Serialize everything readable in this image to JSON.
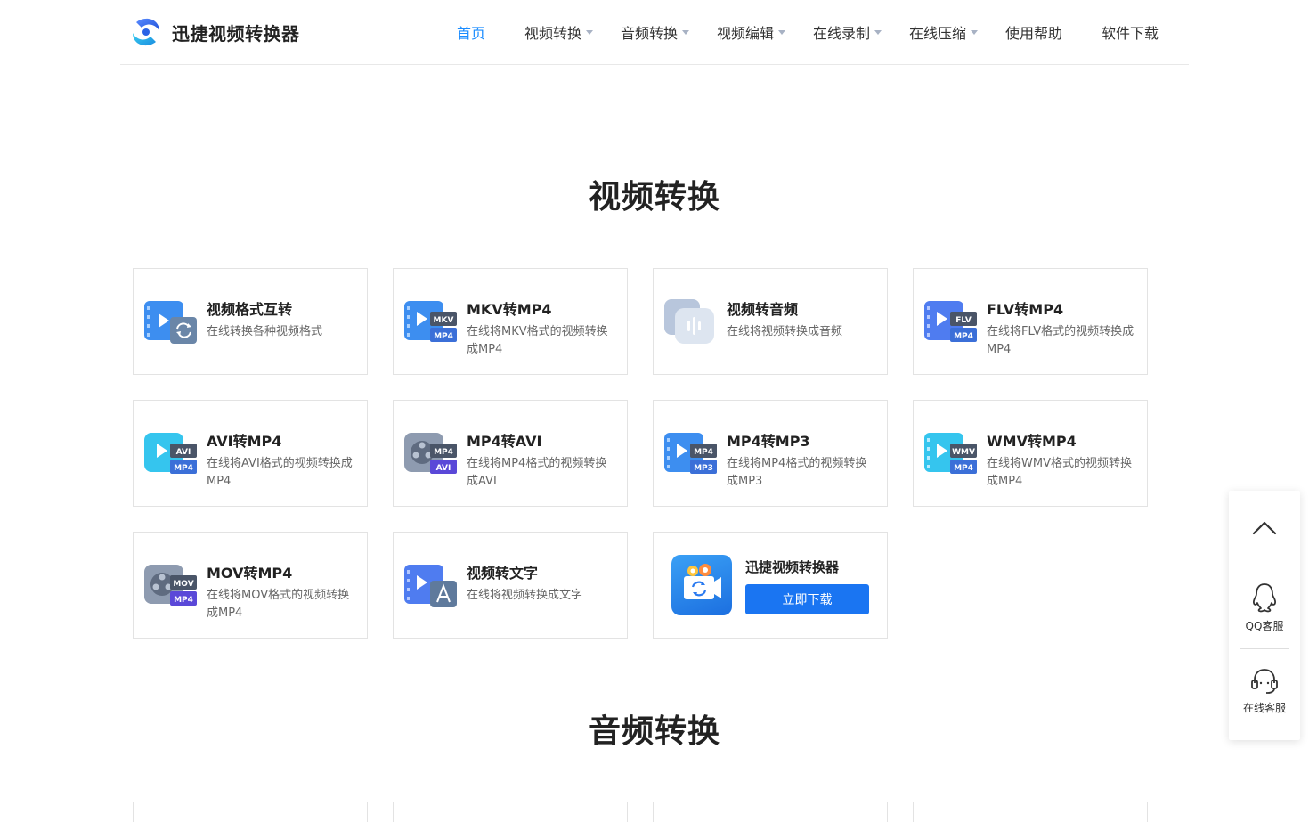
{
  "brand": {
    "name": "迅捷视频转换器"
  },
  "nav": {
    "items": [
      {
        "label": "首页",
        "active": true,
        "dropdown": false
      },
      {
        "label": "视频转换",
        "active": false,
        "dropdown": true
      },
      {
        "label": "音频转换",
        "active": false,
        "dropdown": true
      },
      {
        "label": "视频编辑",
        "active": false,
        "dropdown": true
      },
      {
        "label": "在线录制",
        "active": false,
        "dropdown": true
      },
      {
        "label": "在线压缩",
        "active": false,
        "dropdown": true
      },
      {
        "label": "使用帮助",
        "active": false,
        "dropdown": false
      },
      {
        "label": "软件下载",
        "active": false,
        "dropdown": false
      }
    ]
  },
  "video_section": {
    "title": "视频转换",
    "cards": [
      {
        "title": "视频格式互转",
        "desc": "在线转换各种视频格式",
        "icon": "video-format-convert-icon"
      },
      {
        "title": "MKV转MP4",
        "desc": "在线将MKV格式的视频转换成MP4",
        "icon": "mkv-to-mp4-icon",
        "badges": [
          "MKV",
          "MP4"
        ]
      },
      {
        "title": "视频转音频",
        "desc": "在线将视频转换成音频",
        "icon": "video-to-audio-icon"
      },
      {
        "title": "FLV转MP4",
        "desc": "在线将FLV格式的视频转换成MP4",
        "icon": "flv-to-mp4-icon",
        "badges": [
          "FLV",
          "MP4"
        ]
      },
      {
        "title": "AVI转MP4",
        "desc": "在线将AVI格式的视频转换成MP4",
        "icon": "avi-to-mp4-icon",
        "badges": [
          "AVI",
          "MP4"
        ]
      },
      {
        "title": "MP4转AVI",
        "desc": "在线将MP4格式的视频转换成AVI",
        "icon": "mp4-to-avi-icon",
        "badges": [
          "MP4",
          "AVI"
        ]
      },
      {
        "title": "MP4转MP3",
        "desc": "在线将MP4格式的视频转换成MP3",
        "icon": "mp4-to-mp3-icon",
        "badges": [
          "MP4",
          "MP3"
        ]
      },
      {
        "title": "WMV转MP4",
        "desc": "在线将WMV格式的视频转换成MP4",
        "icon": "wmv-to-mp4-icon",
        "badges": [
          "WMV",
          "MP4"
        ]
      },
      {
        "title": "MOV转MP4",
        "desc": "在线将MOV格式的视频转换成MP4",
        "icon": "mov-to-mp4-icon",
        "badges": [
          "MOV",
          "MP4"
        ]
      },
      {
        "title": "视频转文字",
        "desc": "在线将视频转换成文字",
        "icon": "video-to-text-icon"
      }
    ],
    "promo": {
      "title": "迅捷视频转换器",
      "button": "立即下载"
    }
  },
  "audio_section": {
    "title": "音频转换"
  },
  "sidebar": {
    "items": [
      {
        "label": "QQ客服",
        "icon": "qq-icon"
      },
      {
        "label": "在线客服",
        "icon": "headset-icon"
      }
    ]
  },
  "colors": {
    "accent": "#1a8cff",
    "button": "#1a75f2",
    "badge_dark": "#4a5568",
    "badge_blue": "#3b6fd8"
  }
}
